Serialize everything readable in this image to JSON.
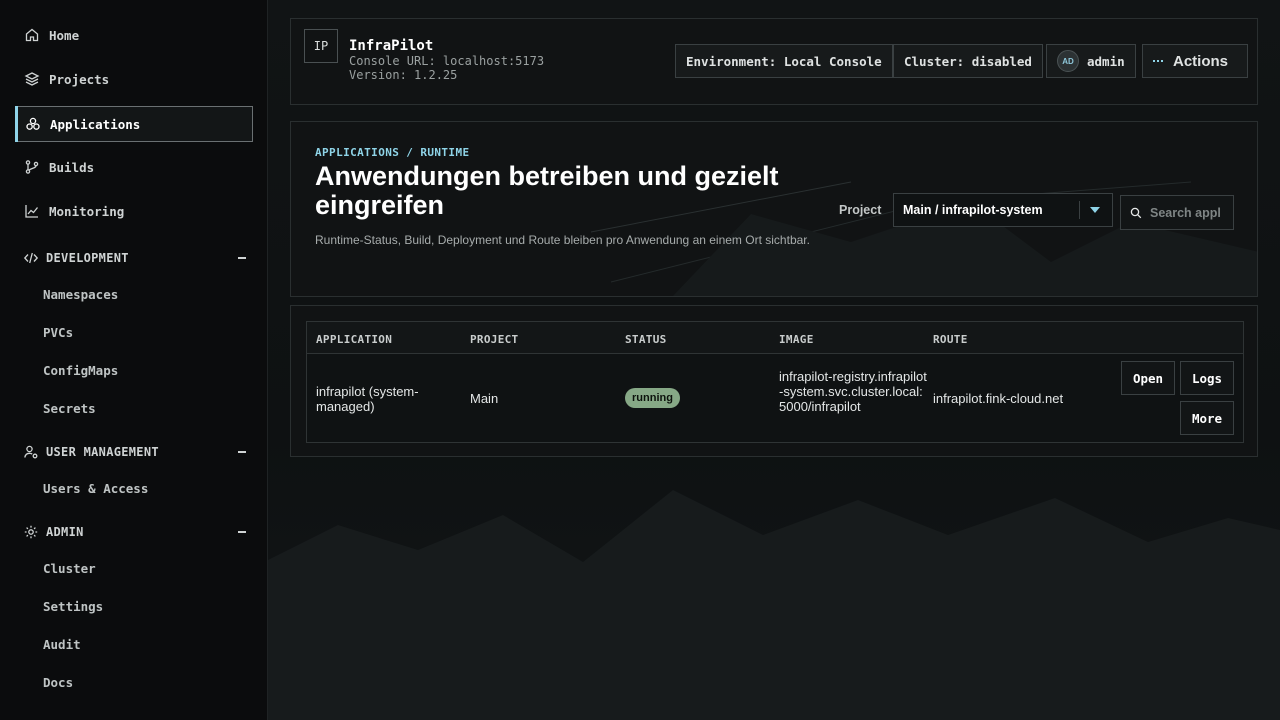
{
  "sidebar": {
    "items": [
      {
        "label": "Home",
        "icon": "home-icon"
      },
      {
        "label": "Projects",
        "icon": "layers-icon"
      },
      {
        "label": "Applications",
        "icon": "apps-icon",
        "active": true
      },
      {
        "label": "Builds",
        "icon": "git-branch-icon"
      },
      {
        "label": "Monitoring",
        "icon": "chart-line-icon"
      }
    ],
    "sections": [
      {
        "label": "DEVELOPMENT",
        "icon": "code-icon",
        "items": [
          "Namespaces",
          "PVCs",
          "ConfigMaps",
          "Secrets"
        ]
      },
      {
        "label": "USER MANAGEMENT",
        "icon": "user-gear-icon",
        "items": [
          "Users & Access"
        ]
      },
      {
        "label": "ADMIN",
        "icon": "gear-icon",
        "items": [
          "Cluster",
          "Settings",
          "Audit",
          "Docs"
        ]
      }
    ]
  },
  "header": {
    "logo": "IP",
    "title": "InfraPilot",
    "console_url": "Console URL: localhost:5173",
    "version": "Version: 1.2.25",
    "environment": "Environment: Local Console",
    "cluster": "Cluster: disabled",
    "avatar_initials": "AD",
    "user": "admin",
    "actions_label": "Actions"
  },
  "hero": {
    "breadcrumb": "APPLICATIONS / RUNTIME",
    "title": "Anwendungen betreiben und gezielt eingreifen",
    "subtitle": "Runtime-Status, Build, Deployment und Route bleiben pro Anwendung an einem Ort sichtbar.",
    "project_label": "Project",
    "project_value": "Main / infrapilot-system",
    "search_placeholder": "Search applications"
  },
  "table": {
    "columns": [
      "APPLICATION",
      "PROJECT",
      "STATUS",
      "IMAGE",
      "ROUTE"
    ],
    "rows": [
      {
        "application": "infrapilot (system-managed)",
        "project": "Main",
        "status": "running",
        "image": "infrapilot-registry.infrapilot-system.svc.cluster.local:5000/infrapilot",
        "route": "infrapilot.fink-cloud.net"
      }
    ],
    "actions": {
      "open": "Open",
      "logs": "Logs",
      "more": "More"
    }
  },
  "colors": {
    "accent": "#8fd4e8",
    "status_running": "#86a886",
    "background": "#0d0f10"
  }
}
